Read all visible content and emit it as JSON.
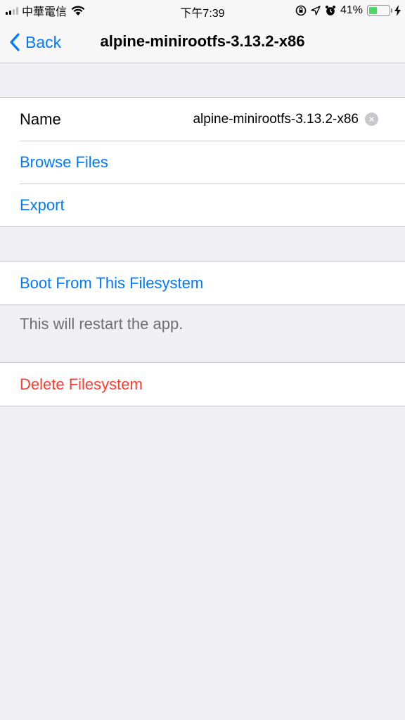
{
  "status_bar": {
    "carrier": "中華電信",
    "time": "下午7:39",
    "battery_percent": "41%",
    "battery_level": 0.41,
    "icons": [
      "signal-icon",
      "wifi-icon",
      "rotation-lock-icon",
      "location-icon",
      "alarm-icon",
      "battery-icon",
      "charging-icon"
    ]
  },
  "nav": {
    "back_label": "Back",
    "title": "alpine-minirootfs-3.13.2-x86"
  },
  "details": {
    "name_label": "Name",
    "name_value": "alpine-minirootfs-3.13.2-x86",
    "browse_label": "Browse Files",
    "export_label": "Export"
  },
  "boot": {
    "label": "Boot From This Filesystem",
    "footer": "This will restart the app."
  },
  "delete": {
    "label": "Delete Filesystem"
  },
  "colors": {
    "accent": "#007aff",
    "danger": "#ff3b30",
    "background": "#efeff4",
    "battery": "#4cd964"
  }
}
